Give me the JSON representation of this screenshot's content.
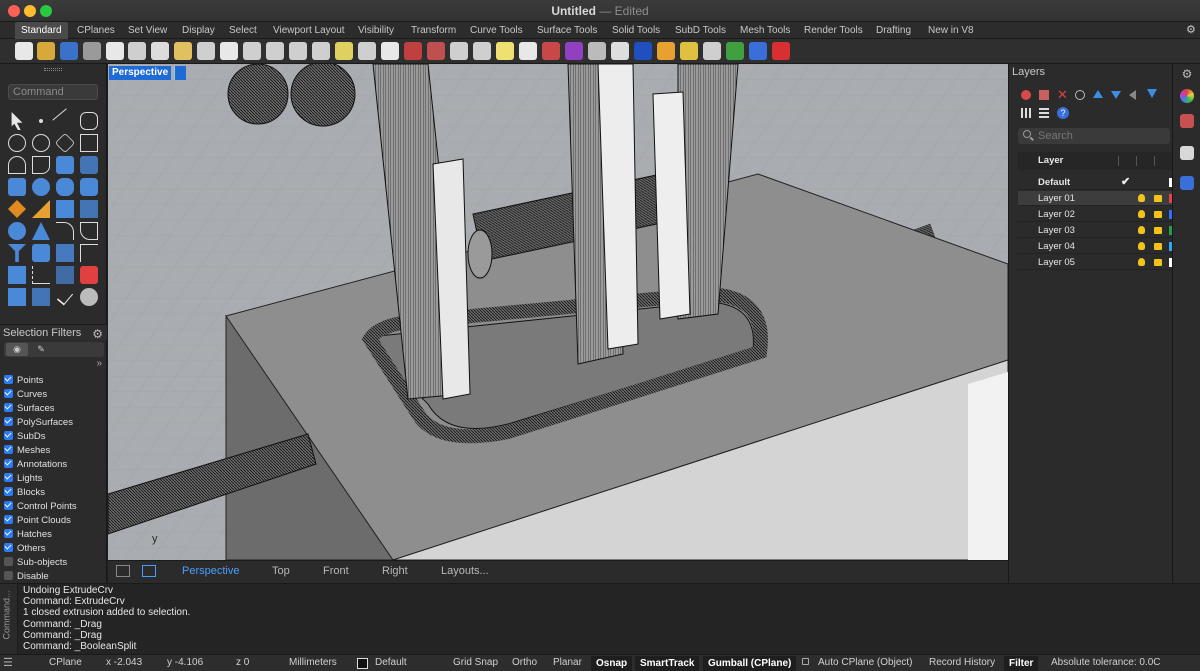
{
  "window": {
    "title": "Untitled",
    "subtitle": "— Edited"
  },
  "tabs": [
    "Standard",
    "CPlanes",
    "Set View",
    "Display",
    "Select",
    "Viewport Layout",
    "Visibility",
    "Transform",
    "Curve Tools",
    "Surface Tools",
    "Solid Tools",
    "SubD Tools",
    "Mesh Tools",
    "Render Tools",
    "Drafting",
    "New in V8"
  ],
  "command_placeholder": "Command",
  "selection_filters": {
    "title": "Selection Filters",
    "items": [
      {
        "label": "Points",
        "checked": true
      },
      {
        "label": "Curves",
        "checked": true
      },
      {
        "label": "Surfaces",
        "checked": true
      },
      {
        "label": "PolySurfaces",
        "checked": true
      },
      {
        "label": "SubDs",
        "checked": true
      },
      {
        "label": "Meshes",
        "checked": true
      },
      {
        "label": "Annotations",
        "checked": true
      },
      {
        "label": "Lights",
        "checked": true
      },
      {
        "label": "Blocks",
        "checked": true
      },
      {
        "label": "Control Points",
        "checked": true
      },
      {
        "label": "Point Clouds",
        "checked": true
      },
      {
        "label": "Hatches",
        "checked": true
      },
      {
        "label": "Others",
        "checked": true
      },
      {
        "label": "Sub-objects",
        "checked": false
      },
      {
        "label": "Disable",
        "checked": false
      }
    ]
  },
  "viewport": {
    "label": "Perspective",
    "axis_label": "y"
  },
  "viewport_tabs": [
    "Perspective",
    "Top",
    "Front",
    "Right",
    "Layouts..."
  ],
  "layers": {
    "title": "Layers",
    "search_placeholder": "Search",
    "header": "Layer",
    "rows": [
      {
        "name": "Default",
        "current": true
      },
      {
        "name": "Layer 01",
        "color": "#e8404b"
      },
      {
        "name": "Layer 02",
        "color": "#2f6fff"
      },
      {
        "name": "Layer 03",
        "color": "#1ea34a"
      },
      {
        "name": "Layer 04",
        "color": "#2aa9ff"
      },
      {
        "name": "Layer 05",
        "color": "#ffffff"
      }
    ]
  },
  "history": {
    "side_label": "Command...",
    "lines": [
      "Undoing ExtrudeCrv",
      "Command: ExtrudeCrv",
      "1 closed extrusion added to selection.",
      "Command: _Drag",
      "Command: _Drag",
      "Command: _BooleanSplit"
    ]
  },
  "status": {
    "cplane": "CPlane",
    "x": "x -2.043",
    "y": "y -4.106",
    "z": "z 0",
    "units": "Millimeters",
    "layer": "Default",
    "grid_snap": "Grid Snap",
    "ortho": "Ortho",
    "planar": "Planar",
    "osnap": "Osnap",
    "smarttrack": "SmartTrack",
    "gumball": "Gumball (CPlane)",
    "auto_cplane": "Auto CPlane (Object)",
    "record_history": "Record History",
    "filter": "Filter",
    "tolerance": "Absolute tolerance: 0.0C"
  }
}
